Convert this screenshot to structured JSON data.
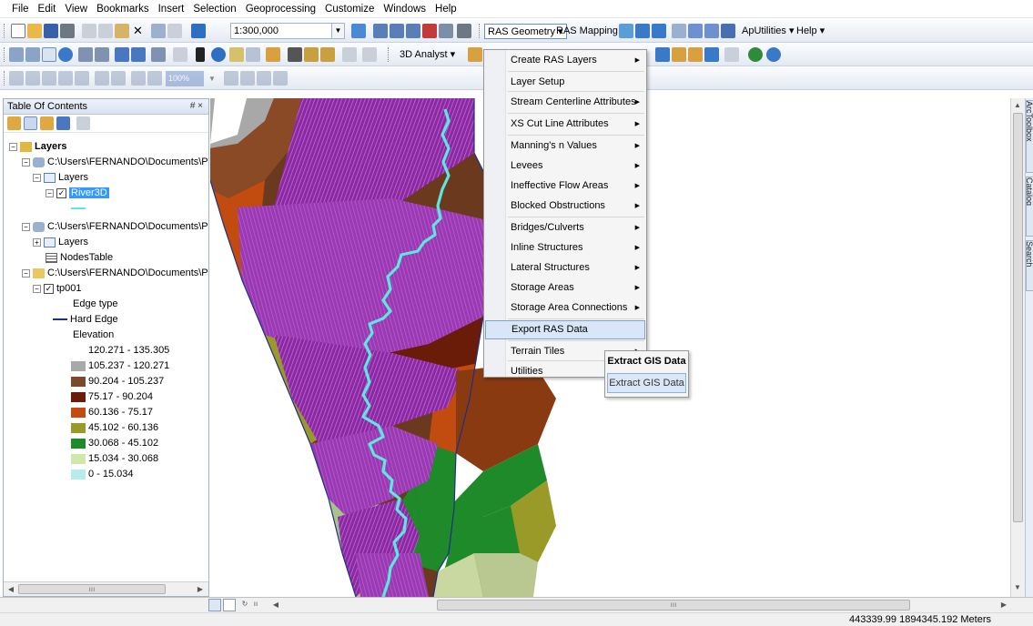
{
  "menubar": [
    "File",
    "Edit",
    "View",
    "Bookmarks",
    "Insert",
    "Selection",
    "Geoprocessing",
    "Customize",
    "Windows",
    "Help"
  ],
  "toolbar": {
    "scale": "1:300,000",
    "ras_geometry": "RAS Geometry",
    "ras_mapping": "RAS Mapping",
    "aputilities": "ApUtilities",
    "help": "Help",
    "analyst_3d": "3D Analyst",
    "zoom_pct": "100%"
  },
  "toc": {
    "title": "Table Of Contents",
    "pin": "# ×",
    "rows": [
      {
        "text": "Layers",
        "bold": true
      },
      {
        "text": "C:\\Users\\FERNANDO\\Documents\\Pl"
      },
      {
        "text": "Layers"
      },
      {
        "text": "River3D"
      },
      {
        "text": "C:\\Users\\FERNANDO\\Documents\\Pl"
      },
      {
        "text": "Layers"
      },
      {
        "text": "NodesTable"
      },
      {
        "text": "C:\\Users\\FERNANDO\\Documents\\Pl"
      },
      {
        "text": "tp001"
      },
      {
        "text": "Edge type"
      },
      {
        "text": "Hard Edge"
      },
      {
        "text": "Elevation"
      }
    ],
    "legend": [
      {
        "label": "120.271 - 135.305",
        "color": "#ffffff"
      },
      {
        "label": "105.237 - 120.271",
        "color": "#a8a8a8"
      },
      {
        "label": "90.204 - 105.237",
        "color": "#7a4a2a"
      },
      {
        "label": "75.17 - 90.204",
        "color": "#6b1c08"
      },
      {
        "label": "60.136 - 75.17",
        "color": "#c24b10"
      },
      {
        "label": "45.102 - 60.136",
        "color": "#9a9a28"
      },
      {
        "label": "30.068 - 45.102",
        "color": "#1f8a2a"
      },
      {
        "label": "15.034 - 30.068",
        "color": "#cfe8a8"
      },
      {
        "label": "0 - 15.034",
        "color": "#b8ecec"
      }
    ]
  },
  "ras_menu": {
    "items": [
      {
        "label": "Create RAS Layers",
        "sub": true
      },
      {
        "label": "Layer Setup",
        "sub": false
      },
      {
        "label": "Stream Centerline Attributes",
        "sub": true
      },
      {
        "label": "XS Cut Line Attributes",
        "sub": true
      },
      {
        "label": "Manning's n Values",
        "sub": true
      },
      {
        "label": "Levees",
        "sub": true
      },
      {
        "label": "Ineffective Flow Areas",
        "sub": true
      },
      {
        "label": "Blocked Obstructions",
        "sub": true
      },
      {
        "label": "Bridges/Culverts",
        "sub": true
      },
      {
        "label": "Inline Structures",
        "sub": true
      },
      {
        "label": "Lateral Structures",
        "sub": true
      },
      {
        "label": "Storage Areas",
        "sub": true
      },
      {
        "label": "Storage Area Connections",
        "sub": true
      },
      {
        "label": "Export RAS Data",
        "sub": false
      },
      {
        "label": "Terrain Tiles",
        "sub": true
      },
      {
        "label": "Utilities",
        "sub": false
      }
    ],
    "submenu": {
      "title": "Extract GIS Data",
      "item": "Extract GIS Data"
    }
  },
  "right_dock": [
    "ArcToolbox",
    "Catalog",
    "Search"
  ],
  "status": {
    "coords": "443339.99 1894345.192 Meters"
  },
  "colors": {
    "river": "#5ee6e0",
    "xs_lines": "#a020c0",
    "accent": "#3399ff"
  }
}
